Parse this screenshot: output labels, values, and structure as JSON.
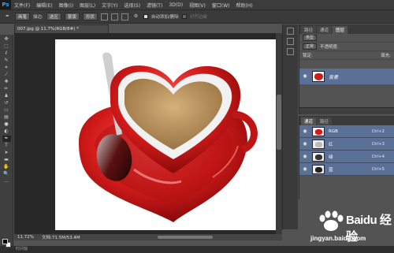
{
  "app": {
    "logo": "Ps"
  },
  "menubar": [
    "文件(F)",
    "编辑(E)",
    "图像(I)",
    "图层(L)",
    "文字(Y)",
    "选择(S)",
    "滤镜(T)",
    "3D(D)",
    "视图(V)",
    "窗口(W)",
    "帮助(H)"
  ],
  "options": {
    "tool_select": "画笔",
    "tolerance_label": "描边:",
    "mode_value": "选区",
    "buttons": [
      "蒙版",
      "形状"
    ],
    "auto_add_delete": "自动添加/删除",
    "align_edges": "对齐边缘"
  },
  "document": {
    "tab_title": "007.jpg @ 11.7%(RGB/8#) *",
    "zoom": "11.72%",
    "doc_size": "文档:71.5M/53.4M"
  },
  "bottom_strip": "时间轴",
  "layers": {
    "tabs": [
      "图层",
      "通道",
      "路径"
    ],
    "kind_filter": "类型",
    "blend_mode": "正常",
    "opacity_label": "不透明度:",
    "lock_label": "锁定:",
    "fill_label": "填充:",
    "layer_name": "背景"
  },
  "channels": {
    "tabs": [
      "通道",
      "路径"
    ],
    "rows": [
      {
        "name": "RGB",
        "shortcut": "Ctrl+2"
      },
      {
        "name": "红",
        "shortcut": "Ctrl+3"
      },
      {
        "name": "绿",
        "shortcut": "Ctrl+4"
      },
      {
        "name": "蓝",
        "shortcut": "Ctrl+5"
      }
    ]
  },
  "watermark": {
    "brand": "Baidu 经验",
    "url": "jingyan.baidu.com"
  },
  "colors": {
    "accent_selection": "#5b7096",
    "cup_red": "#d21a1a",
    "coffee": "#b8915a"
  }
}
